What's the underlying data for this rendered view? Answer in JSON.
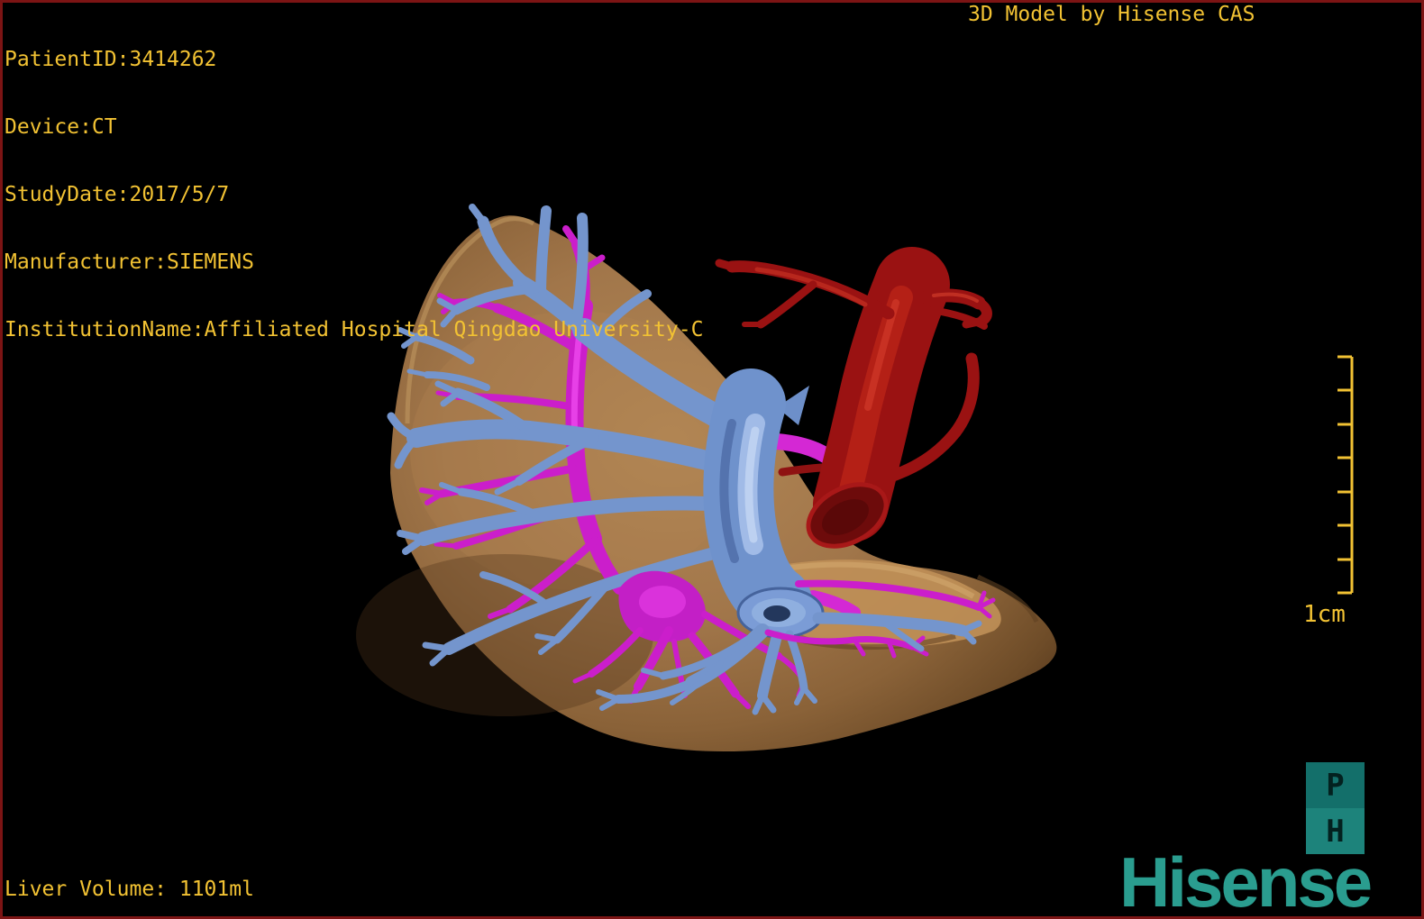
{
  "header": {
    "patient_id": "PatientID:3414262",
    "device": "Device:CT",
    "study_date": "StudyDate:2017/5/7",
    "manufacturer": "Manufacturer:SIEMENS",
    "institution": "InstitutionName:Affiliated Hospital Qingdao University-C",
    "watermark": "3D Model by Hisense CAS"
  },
  "footer": {
    "liver_volume": "Liver Volume: 1101ml"
  },
  "scale_bar": {
    "label": "1cm",
    "tick_count": 8
  },
  "branding": {
    "wordmark": "Hisense",
    "block_top_letter": "P",
    "block_bottom_letter": "H"
  },
  "model": {
    "structures": [
      "liver-parenchyma",
      "portal-vein-blue",
      "hepatic-vein-magenta",
      "artery-red"
    ]
  },
  "colors": {
    "annotation_text": "#f2c233",
    "border": "#7c1414",
    "background": "#000000",
    "liver": "#a1764a",
    "portal_vein": "#7b9cd6",
    "hepatic_vein": "#cb1ecb",
    "artery": "#9a1212",
    "brand_teal": "#2a9d8f"
  }
}
